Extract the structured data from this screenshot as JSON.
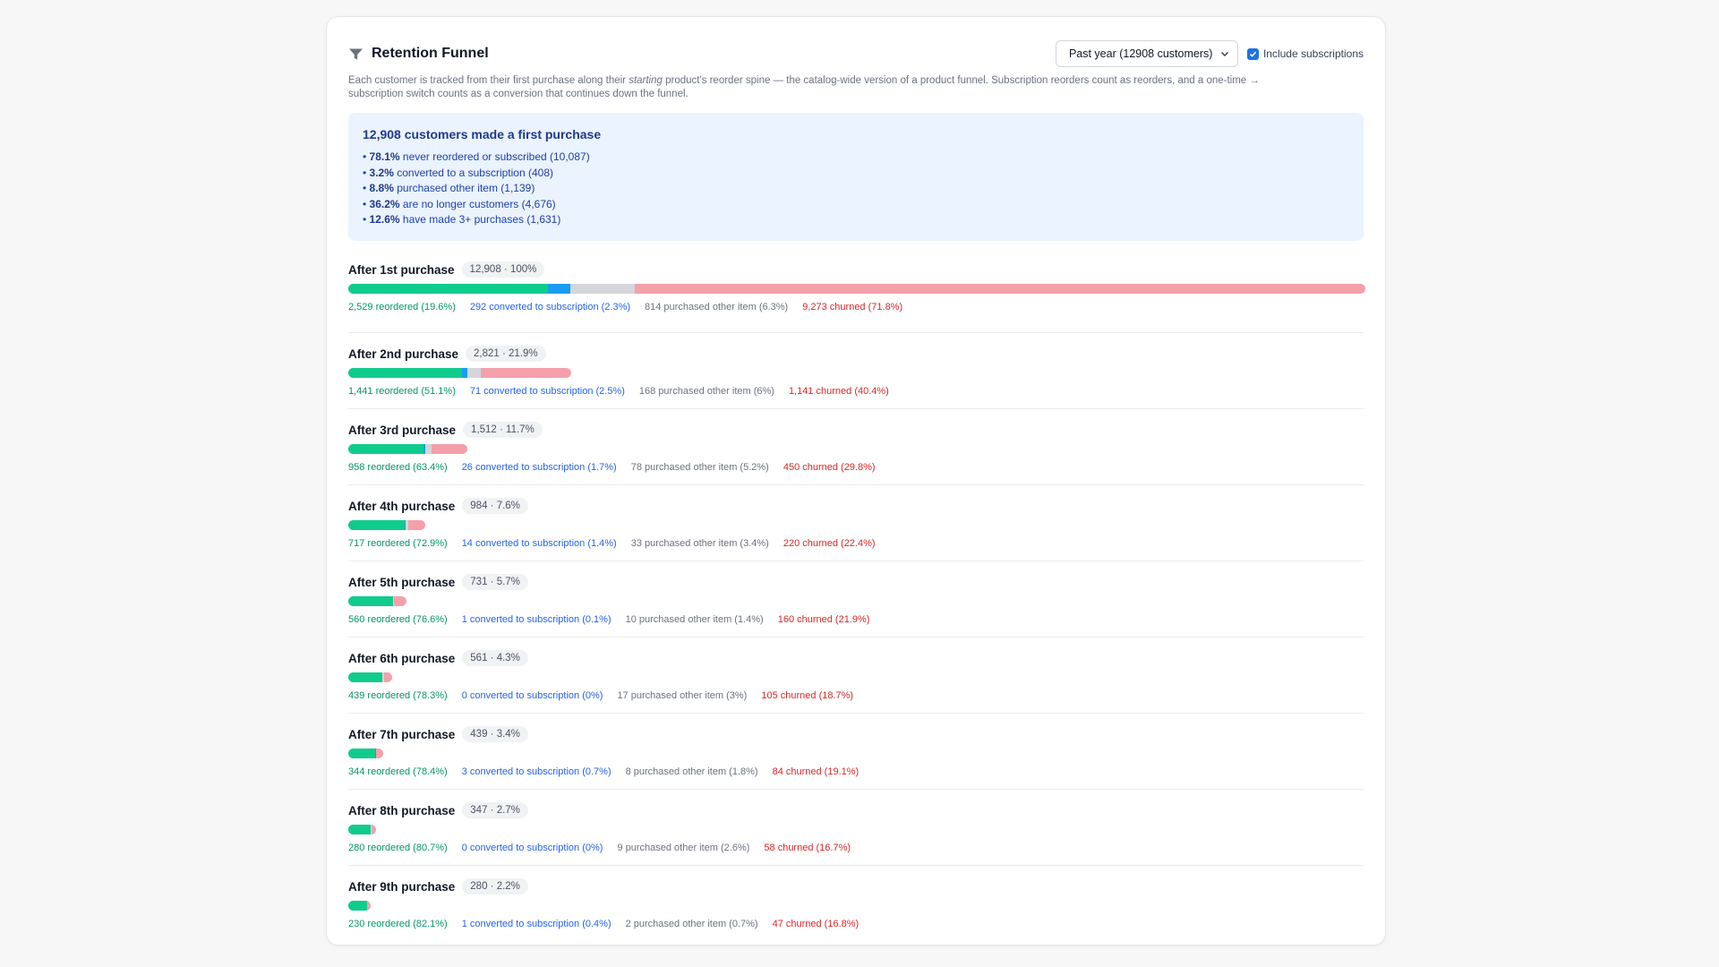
{
  "header": {
    "title": "Retention Funnel",
    "period_select": "Past year (12908 customers)",
    "checkbox_label": "Include subscriptions",
    "checkbox_checked": true
  },
  "description": {
    "part1": "Each customer is tracked from their first purchase along their ",
    "emphasis": "starting",
    "part2": " product's reorder spine — the catalog-wide version of a product funnel. Subscription reorders count as reorders, and a one-time → subscription switch counts as a conversion that continues down the funnel."
  },
  "summary": {
    "title": "12,908 customers made a first purchase",
    "items": [
      {
        "pct": "78.1%",
        "text": " never reordered or subscribed (10,087)"
      },
      {
        "pct": "3.2%",
        "text": " converted to a subscription (408)"
      },
      {
        "pct": "8.8%",
        "text": " purchased other item (1,139)"
      },
      {
        "pct": "36.2%",
        "text": " are no longer customers (4,676)"
      },
      {
        "pct": "12.6%",
        "text": " have made 3+ purchases (1,631)"
      }
    ]
  },
  "colors": {
    "reordered": "#10cc8c",
    "subscription": "#1a9cf0",
    "other": "#d4d6da",
    "churned": "#f4a0aa"
  },
  "stages": [
    {
      "label": "After 1st purchase",
      "badge": "12,908 · 100%",
      "share_of_first": 1.0,
      "reordered": 2529,
      "subscription": 292,
      "other": 814,
      "churned": 9273,
      "reordered_text": "2,529 reordered (19.6%)",
      "subscription_text": "292 converted to subscription (2.3%)",
      "other_text": "814 purchased other item (6.3%)",
      "churned_text": "9,273 churned (71.8%)"
    },
    {
      "label": "After 2nd purchase",
      "badge": "2,821 · 21.9%",
      "share_of_first": 0.219,
      "reordered": 1441,
      "subscription": 71,
      "other": 168,
      "churned": 1141,
      "reordered_text": "1,441 reordered (51.1%)",
      "subscription_text": "71 converted to subscription (2.5%)",
      "other_text": "168 purchased other item (6%)",
      "churned_text": "1,141 churned (40.4%)"
    },
    {
      "label": "After 3rd purchase",
      "badge": "1,512 · 11.7%",
      "share_of_first": 0.117,
      "reordered": 958,
      "subscription": 26,
      "other": 78,
      "churned": 450,
      "reordered_text": "958 reordered (63.4%)",
      "subscription_text": "26 converted to subscription (1.7%)",
      "other_text": "78 purchased other item (5.2%)",
      "churned_text": "450 churned (29.8%)"
    },
    {
      "label": "After 4th purchase",
      "badge": "984 · 7.6%",
      "share_of_first": 0.076,
      "reordered": 717,
      "subscription": 14,
      "other": 33,
      "churned": 220,
      "reordered_text": "717 reordered (72.9%)",
      "subscription_text": "14 converted to subscription (1.4%)",
      "other_text": "33 purchased other item (3.4%)",
      "churned_text": "220 churned (22.4%)"
    },
    {
      "label": "After 5th purchase",
      "badge": "731 · 5.7%",
      "share_of_first": 0.057,
      "reordered": 560,
      "subscription": 1,
      "other": 10,
      "churned": 160,
      "reordered_text": "560 reordered (76.6%)",
      "subscription_text": "1 converted to subscription (0.1%)",
      "other_text": "10 purchased other item (1.4%)",
      "churned_text": "160 churned (21.9%)"
    },
    {
      "label": "After 6th purchase",
      "badge": "561 · 4.3%",
      "share_of_first": 0.043,
      "reordered": 439,
      "subscription": 0,
      "other": 17,
      "churned": 105,
      "reordered_text": "439 reordered (78.3%)",
      "subscription_text": "0 converted to subscription (0%)",
      "other_text": "17 purchased other item (3%)",
      "churned_text": "105 churned (18.7%)"
    },
    {
      "label": "After 7th purchase",
      "badge": "439 · 3.4%",
      "share_of_first": 0.034,
      "reordered": 344,
      "subscription": 3,
      "other": 8,
      "churned": 84,
      "reordered_text": "344 reordered (78.4%)",
      "subscription_text": "3 converted to subscription (0.7%)",
      "other_text": "8 purchased other item (1.8%)",
      "churned_text": "84 churned (19.1%)"
    },
    {
      "label": "After 8th purchase",
      "badge": "347 · 2.7%",
      "share_of_first": 0.027,
      "reordered": 280,
      "subscription": 0,
      "other": 9,
      "churned": 58,
      "reordered_text": "280 reordered (80.7%)",
      "subscription_text": "0 converted to subscription (0%)",
      "other_text": "9 purchased other item (2.6%)",
      "churned_text": "58 churned (16.7%)"
    },
    {
      "label": "After 9th purchase",
      "badge": "280 · 2.2%",
      "share_of_first": 0.022,
      "reordered": 230,
      "subscription": 1,
      "other": 2,
      "churned": 47,
      "reordered_text": "230 reordered (82.1%)",
      "subscription_text": "1 converted to subscription (0.4%)",
      "other_text": "2 purchased other item (0.7%)",
      "churned_text": "47 churned (16.8%)"
    }
  ]
}
